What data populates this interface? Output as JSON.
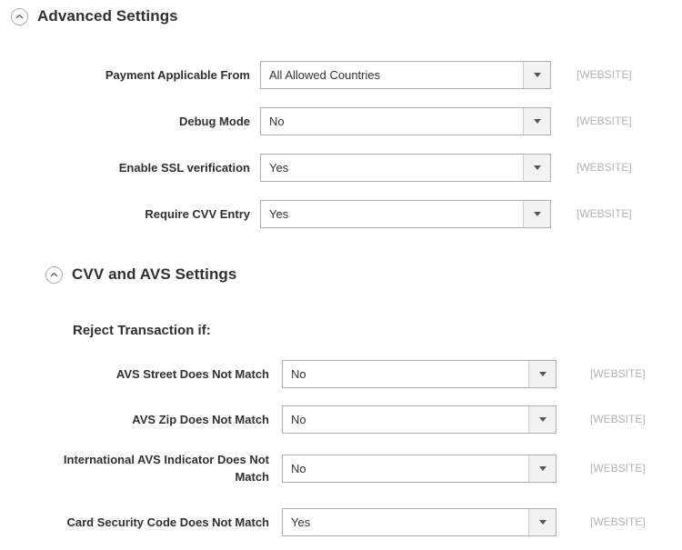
{
  "sections": [
    {
      "id": "advanced-settings",
      "title": "Advanced Settings",
      "collapse_icon": "chevron-up-circle-icon",
      "fields": [
        {
          "label": "Payment Applicable From",
          "value": "All Allowed Countries",
          "scope": "[WEBSITE]",
          "caret_icon": "caret-down-icon"
        },
        {
          "label": "Debug Mode",
          "value": "No",
          "scope": "[WEBSITE]",
          "caret_icon": "caret-down-icon"
        },
        {
          "label": "Enable SSL verification",
          "value": "Yes",
          "scope": "[WEBSITE]",
          "caret_icon": "caret-down-icon"
        },
        {
          "label": "Require CVV Entry",
          "value": "Yes",
          "scope": "[WEBSITE]",
          "caret_icon": "caret-down-icon"
        }
      ]
    },
    {
      "id": "cvv-avs-settings",
      "title": "CVV and AVS Settings",
      "collapse_icon": "chevron-up-circle-icon",
      "subheading": "Reject Transaction if:",
      "fields": [
        {
          "label": "AVS Street Does Not Match",
          "value": "No",
          "scope": "[WEBSITE]",
          "caret_icon": "caret-down-icon"
        },
        {
          "label": "AVS Zip Does Not Match",
          "value": "No",
          "scope": "[WEBSITE]",
          "caret_icon": "caret-down-icon"
        },
        {
          "label": "International AVS Indicator Does Not Match",
          "value": "No",
          "scope": "[WEBSITE]",
          "caret_icon": "caret-down-icon"
        },
        {
          "label": "Card Security Code Does Not Match",
          "value": "Yes",
          "scope": "[WEBSITE]",
          "caret_icon": "caret-down-icon"
        }
      ]
    }
  ],
  "colors": {
    "background": "#ffffff",
    "label_text": "#303030",
    "value_text": "#333333",
    "scope_text": "#b3b3b3",
    "field_border": "#adadad",
    "button_face": "#f2f2f2"
  }
}
